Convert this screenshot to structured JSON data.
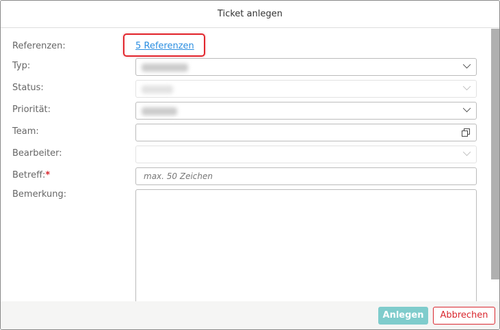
{
  "title": "Ticket anlegen",
  "labels": {
    "referenzen": "Referenzen:",
    "typ": "Typ:",
    "status": "Status:",
    "prioritaet": "Priorität:",
    "team": "Team:",
    "bearbeiter": "Bearbeiter:",
    "betreff": "Betreff:",
    "required_mark": "*",
    "bemerkung": "Bemerkung:"
  },
  "referenzen_link": "5 Referenzen",
  "betreff_placeholder": "max. 50 Zeichen",
  "buttons": {
    "anlegen": "Anlegen",
    "abbrechen": "Abbrechen"
  },
  "colors": {
    "accent": "#7fcccc",
    "danger": "#d9262d",
    "link": "#2a8de0"
  }
}
